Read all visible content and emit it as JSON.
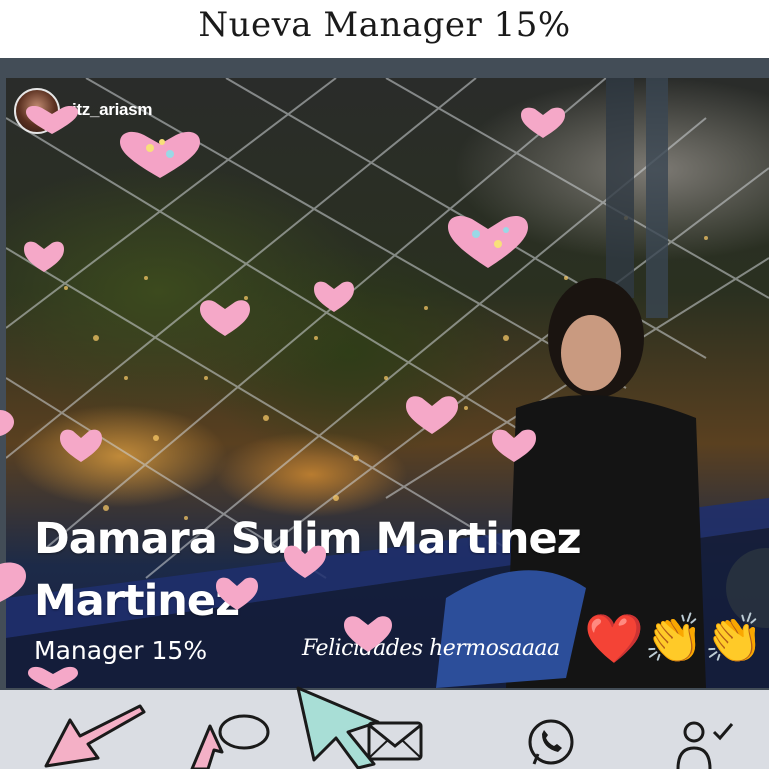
{
  "title": "Nueva Manager 15%",
  "story": {
    "username": "itz_ariasm",
    "name_line1": "Damara Sulim Martinez",
    "name_line2": "Martinez",
    "role": "Manager 15%",
    "congrats": "Felicidades hermosaaaa",
    "emojis": [
      "❤️",
      "👏",
      "👏"
    ]
  },
  "share_bar": {
    "icons": [
      "share-arrow-icon",
      "comment-bubble-icon",
      "cursor-arrow-icon",
      "mail-icon",
      "whatsapp-icon",
      "add-person-icon"
    ]
  },
  "colors": {
    "frame": "#434d57",
    "bar": "#dadde3",
    "heart": "#f5a8c8"
  }
}
